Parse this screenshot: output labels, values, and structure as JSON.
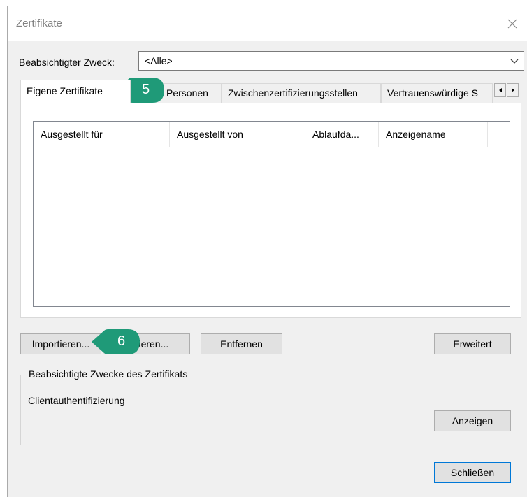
{
  "window": {
    "title": "Zertifikate",
    "close_icon": "close-icon"
  },
  "purpose": {
    "label": "Beabsichtigter Zweck:",
    "value": "<Alle>"
  },
  "tabs": [
    {
      "label": "Eigene Zertifikate",
      "active": true
    },
    {
      "label": "Personen",
      "active": false
    },
    {
      "label": "Zwischenzertifizierungsstellen",
      "active": false
    },
    {
      "label": "Vertrauenswürdige S",
      "active": false
    }
  ],
  "list": {
    "columns": [
      "Ausgestellt für",
      "Ausgestellt von",
      "Ablaufda...",
      "Anzeigename"
    ]
  },
  "buttons": {
    "import": "Importieren...",
    "export": "Exportieren...",
    "remove": "Entfernen",
    "advanced": "Erweitert",
    "view": "Anzeigen",
    "close": "Schließen"
  },
  "purposes_group": {
    "title": "Beabsichtigte Zwecke des Zertifikats",
    "value": "Clientauthentifizierung"
  },
  "callouts": [
    {
      "number": "5",
      "color": "#1f9a78"
    },
    {
      "number": "6",
      "color": "#1f9a78"
    }
  ]
}
